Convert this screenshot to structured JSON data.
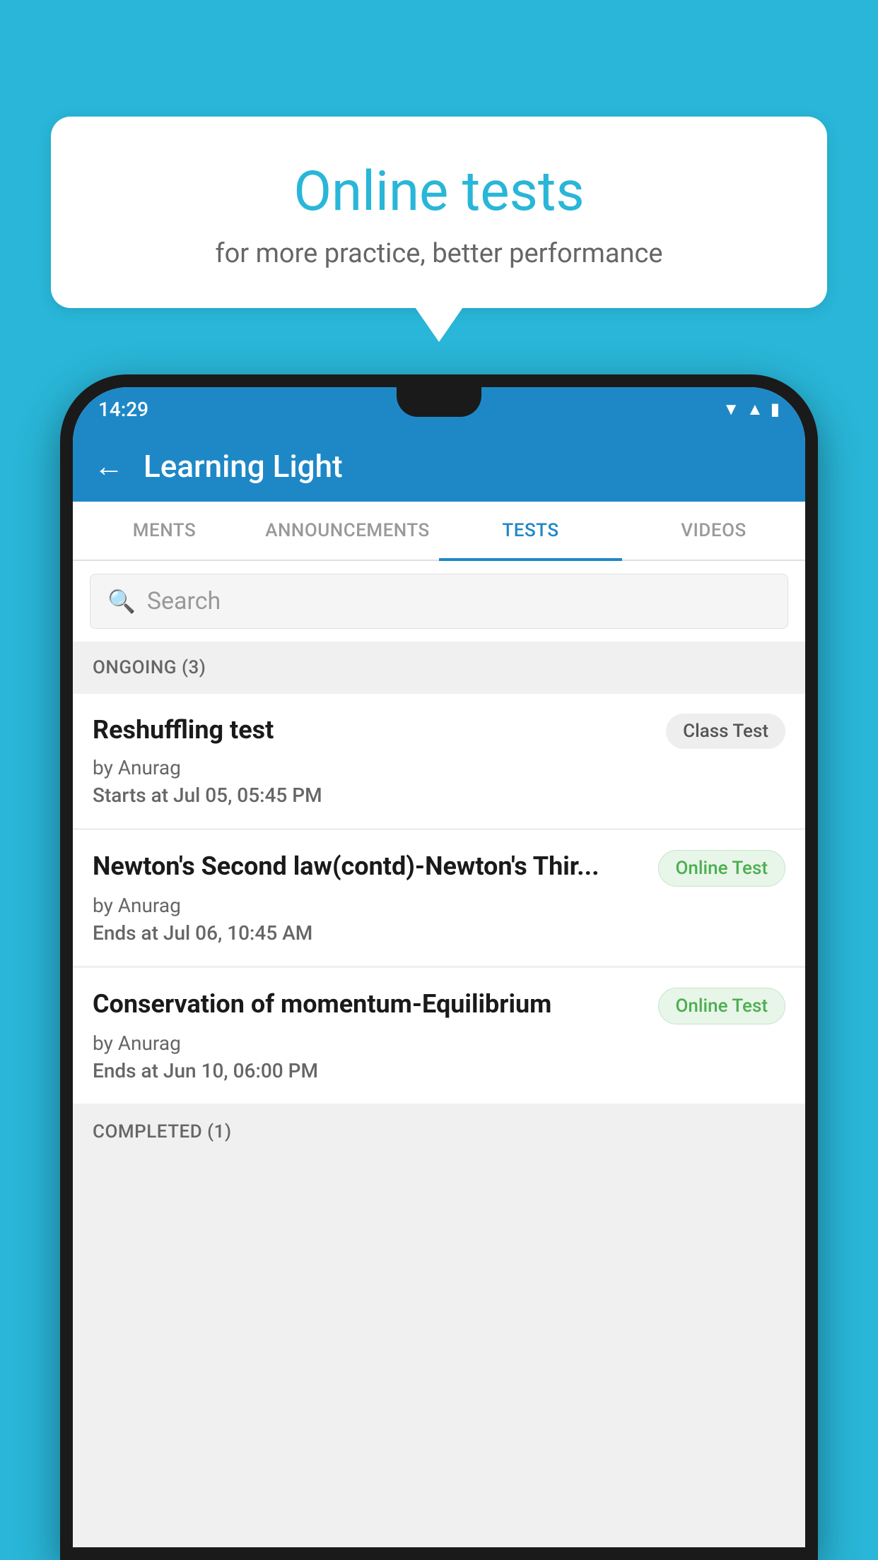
{
  "background_color": "#29b6d8",
  "speech_bubble": {
    "title": "Online tests",
    "subtitle": "for more practice, better performance"
  },
  "status_bar": {
    "time": "14:29",
    "icons": [
      "wifi",
      "signal",
      "battery"
    ]
  },
  "app_bar": {
    "title": "Learning Light",
    "back_label": "←"
  },
  "tabs": [
    {
      "label": "MENTS",
      "active": false
    },
    {
      "label": "ANNOUNCEMENTS",
      "active": false
    },
    {
      "label": "TESTS",
      "active": true
    },
    {
      "label": "VIDEOS",
      "active": false
    }
  ],
  "search": {
    "placeholder": "Search"
  },
  "sections": [
    {
      "header": "ONGOING (3)",
      "tests": [
        {
          "title": "Reshuffling test",
          "badge": "Class Test",
          "badge_type": "class",
          "by": "by Anurag",
          "time_label": "Starts at",
          "time_value": "Jul 05, 05:45 PM"
        },
        {
          "title": "Newton's Second law(contd)-Newton's Thir...",
          "badge": "Online Test",
          "badge_type": "online",
          "by": "by Anurag",
          "time_label": "Ends at",
          "time_value": "Jul 06, 10:45 AM"
        },
        {
          "title": "Conservation of momentum-Equilibrium",
          "badge": "Online Test",
          "badge_type": "online",
          "by": "by Anurag",
          "time_label": "Ends at",
          "time_value": "Jun 10, 06:00 PM"
        }
      ]
    },
    {
      "header": "COMPLETED (1)",
      "tests": []
    }
  ]
}
